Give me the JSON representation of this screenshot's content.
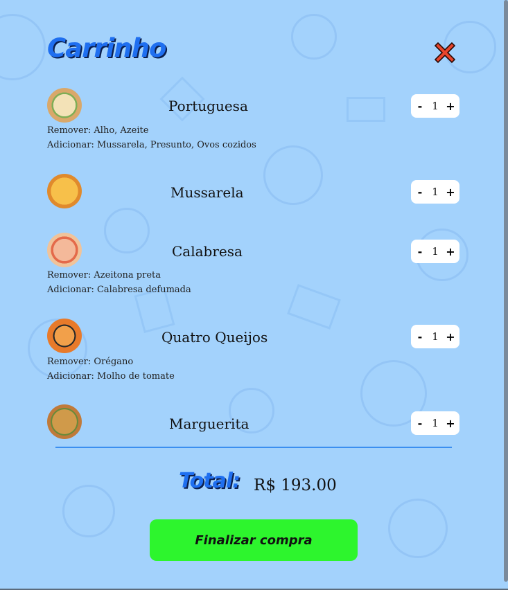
{
  "cart": {
    "title": "Carrinho",
    "close_icon": "close-x-icon",
    "items": [
      {
        "name": "Portuguesa",
        "quantity": "1",
        "remove": "Remover: Alho, Azeite",
        "add": "Adicionar: Mussarela, Presunto, Ovos cozidos",
        "thumb_color": "#c98a4b"
      },
      {
        "name": "Mussarela",
        "quantity": "1",
        "remove": "",
        "add": "",
        "thumb_color": "#e08a2c"
      },
      {
        "name": "Calabresa",
        "quantity": "1",
        "remove": "Remover: Azeitona preta",
        "add": "Adicionar: Calabresa defumada",
        "thumb_color": "#e59a7a"
      },
      {
        "name": "Quatro Queijos",
        "quantity": "1",
        "remove": "Remover: Orégano",
        "add": "Adicionar: Molho de tomate",
        "thumb_color": "#d0601f"
      },
      {
        "name": "Marguerita",
        "quantity": "1",
        "remove": "",
        "add": "",
        "thumb_color": "#b87a3a"
      }
    ],
    "minus_label": "-",
    "plus_label": "+",
    "total_label": "Total:",
    "total_value": "R$ 193.00",
    "checkout_label": "Finalizar compra"
  },
  "colors": {
    "background": "#a3d2fc",
    "accent": "#1f6ff0",
    "checkout": "#2df52d",
    "close": "#e8452c"
  }
}
